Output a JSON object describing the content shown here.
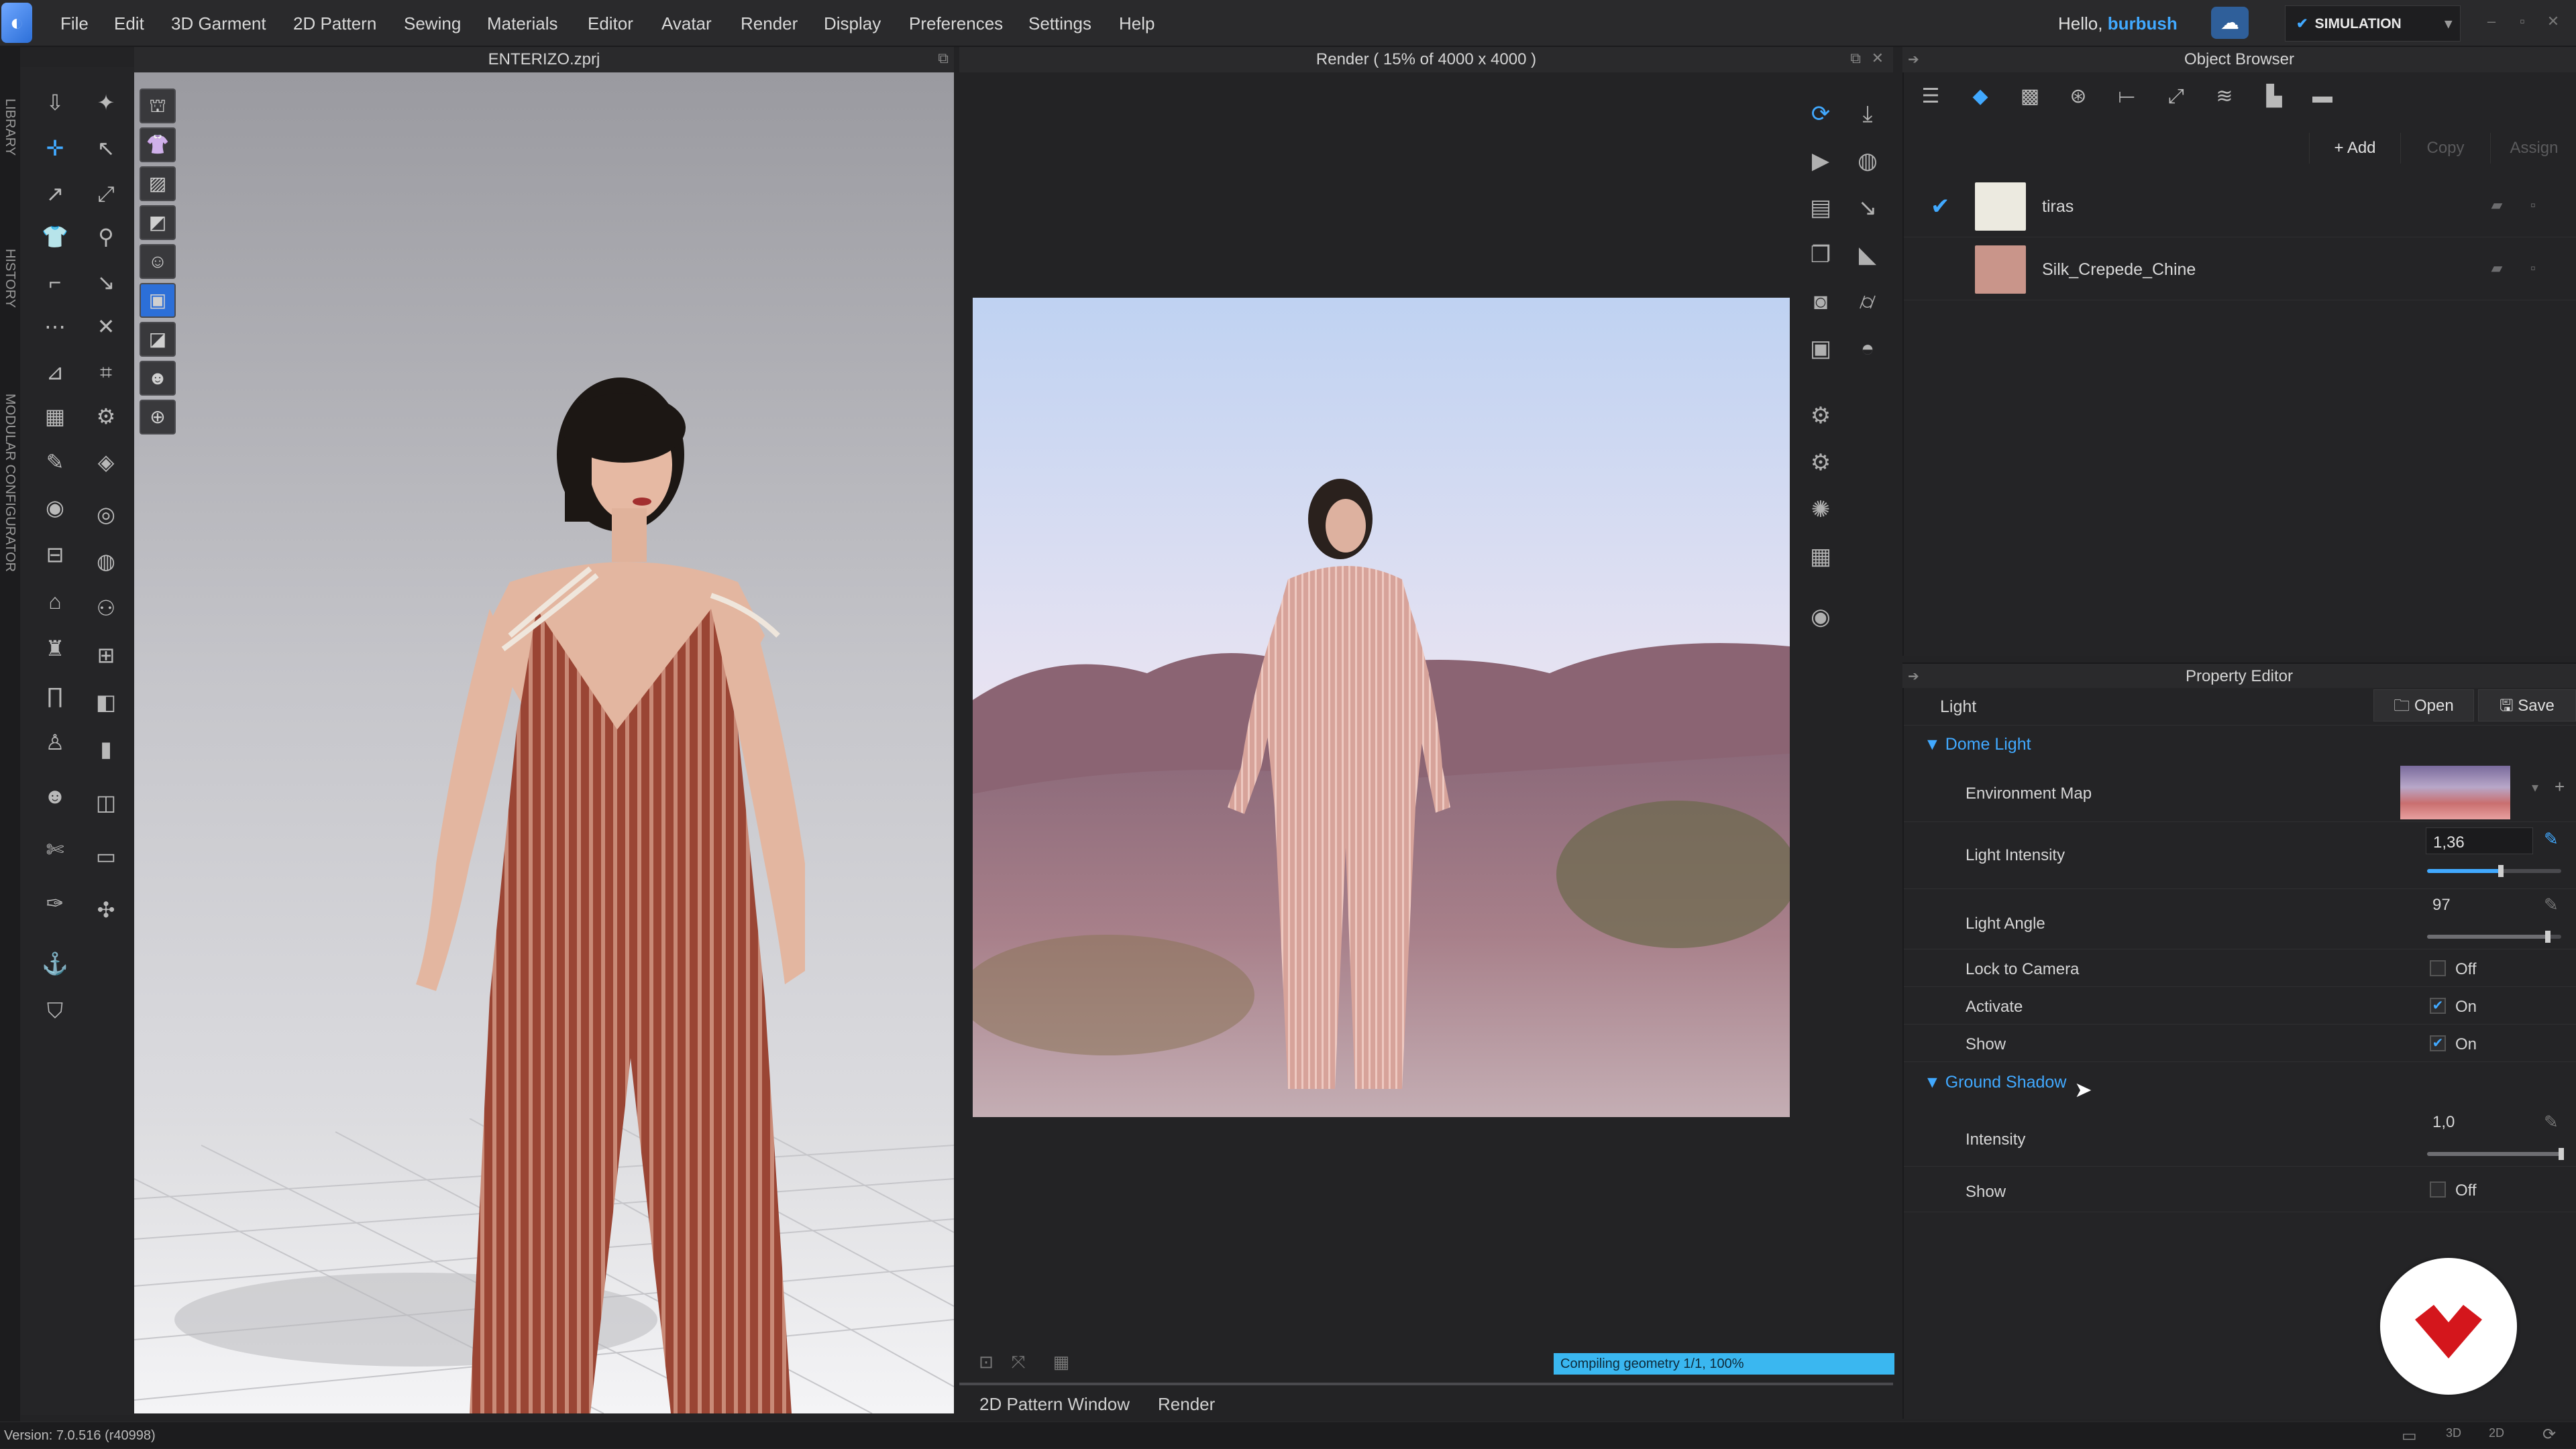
{
  "menu": {
    "logo": "◐",
    "items": [
      "File",
      "Edit",
      "3D Garment",
      "2D Pattern",
      "Sewing",
      "Materials",
      "Editor",
      "Avatar",
      "Render",
      "Display",
      "Preferences",
      "Settings",
      "Help"
    ],
    "greeting": "Hello,",
    "username": "burbush",
    "simulation_label": "SIMULATION"
  },
  "side_tabs": [
    "LIBRARY",
    "HISTORY",
    "MODULAR CONFIGURATOR"
  ],
  "viewport3d": {
    "title": "ENTERIZO.zprj"
  },
  "render": {
    "title": "Render ( 15% of 4000 x 4000 )",
    "progress_text": "Compiling geometry 1/1, 100%",
    "progress": 1.0,
    "bottom_tabs": [
      "2D Pattern Window",
      "Render"
    ]
  },
  "object_browser": {
    "title": "Object Browser",
    "buttons": {
      "add": "+ Add",
      "copy": "Copy",
      "assign": "Assign"
    },
    "materials": [
      {
        "name": "tiras",
        "color": "#eceae0",
        "selected": true
      },
      {
        "name": "Silk_Crepede_Chine",
        "color": "#c9958a",
        "selected": false
      }
    ]
  },
  "property_editor": {
    "title": "Property Editor",
    "object": "Light",
    "open_label": "Open",
    "save_label": "Save",
    "dome_light": {
      "label": "Dome Light",
      "environment_map": "Environment Map",
      "light_intensity_label": "Light Intensity",
      "light_intensity": "1,36",
      "light_intensity_level": 0.55,
      "light_angle_label": "Light Angle",
      "light_angle": "97",
      "light_angle_level": 0.9,
      "lock_to_camera_label": "Lock to Camera",
      "lock_to_camera": "Off",
      "activate_label": "Activate",
      "activate": "On",
      "show_label": "Show",
      "show": "On"
    },
    "ground_shadow": {
      "label": "Ground Shadow",
      "intensity_label": "Intensity",
      "intensity": "1,0",
      "intensity_level": 1.0,
      "show_label": "Show",
      "show": "Off"
    }
  },
  "status": {
    "version": "Version: 7.0.516 (r40998)"
  }
}
